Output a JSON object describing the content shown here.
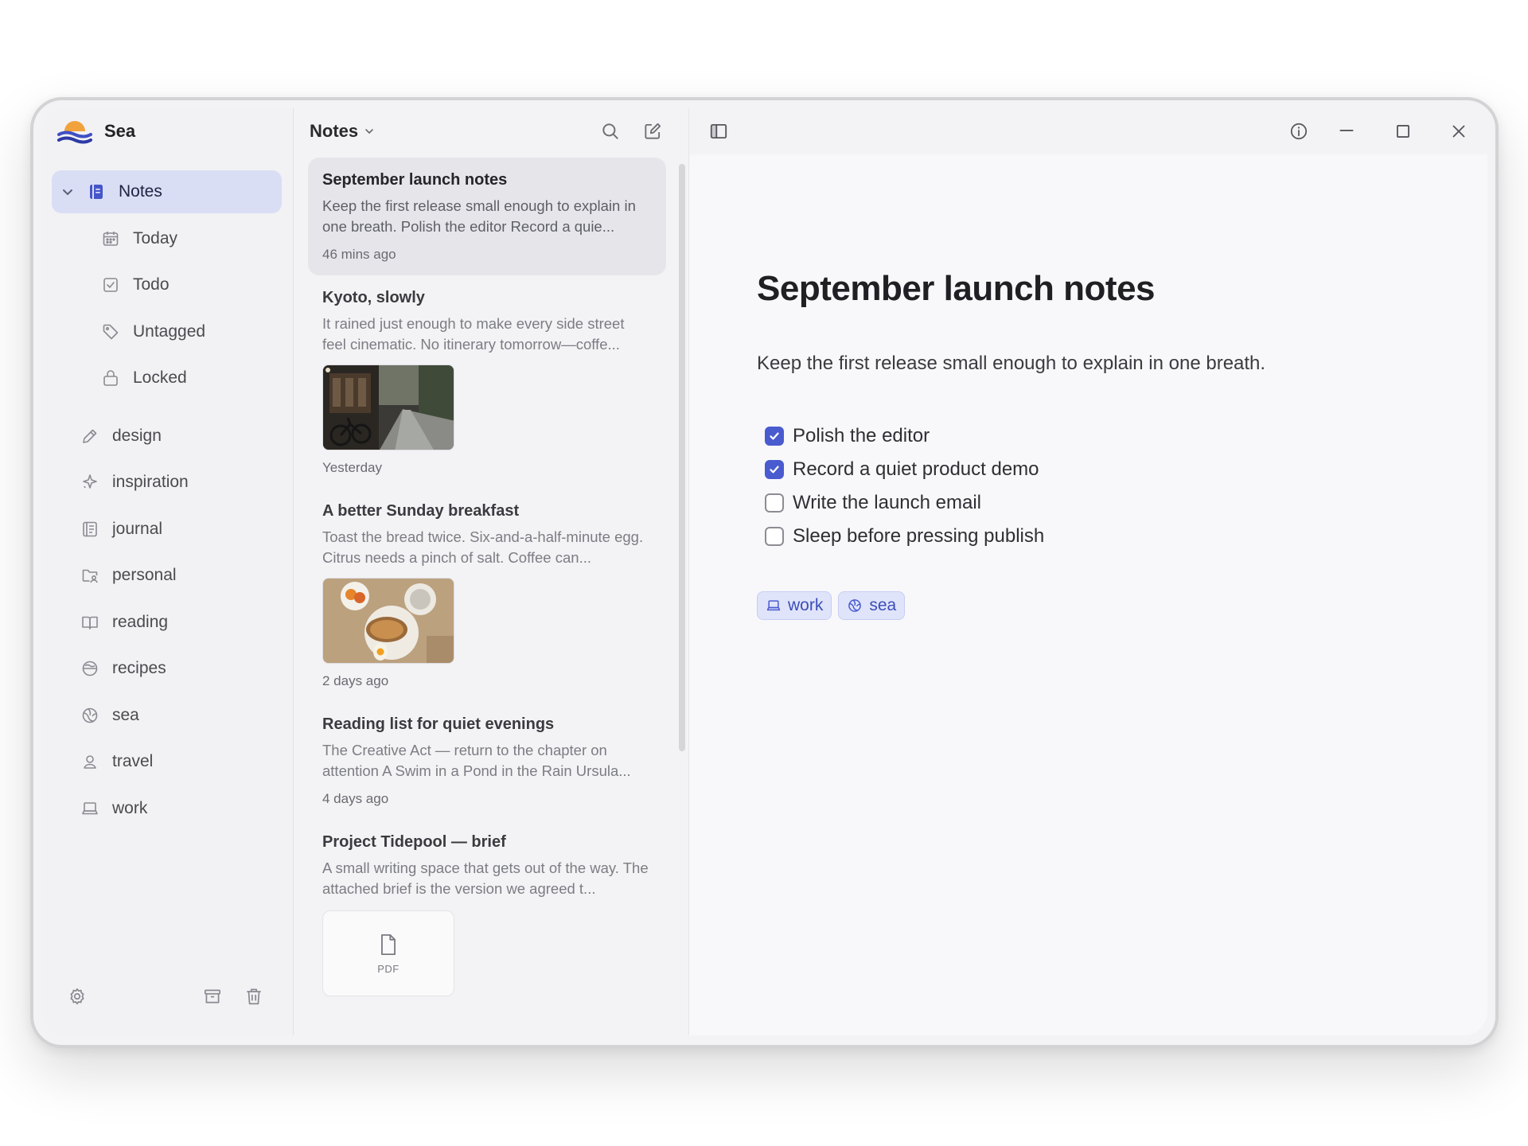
{
  "app": {
    "name": "Sea"
  },
  "sidebar": {
    "notes_label": "Notes",
    "sub_items": [
      {
        "label": "Today",
        "icon": "calendar-icon"
      },
      {
        "label": "Todo",
        "icon": "checkbox-icon"
      },
      {
        "label": "Untagged",
        "icon": "tag-icon"
      },
      {
        "label": "Locked",
        "icon": "lock-icon"
      }
    ],
    "tags": [
      {
        "label": "design",
        "icon": "pencil-icon"
      },
      {
        "label": "inspiration",
        "icon": "sparkle-icon"
      },
      {
        "label": "journal",
        "icon": "journal-icon"
      },
      {
        "label": "personal",
        "icon": "folder-user-icon"
      },
      {
        "label": "reading",
        "icon": "book-icon"
      },
      {
        "label": "recipes",
        "icon": "bowl-icon"
      },
      {
        "label": "sea",
        "icon": "globe-icon"
      },
      {
        "label": "travel",
        "icon": "pin-icon"
      },
      {
        "label": "work",
        "icon": "laptop-icon"
      }
    ]
  },
  "list": {
    "title": "Notes",
    "notes": [
      {
        "title": "September launch notes",
        "snippet": "Keep the first release small enough to explain in one breath. Polish the editor Record a quie...",
        "time": "46 mins ago"
      },
      {
        "title": "Kyoto, slowly",
        "snippet": "It rained just enough to make every side street feel cinematic. No itinerary tomorrow—coffe...",
        "time": "Yesterday",
        "attachment": "photo"
      },
      {
        "title": "A better Sunday breakfast",
        "snippet": "Toast the bread twice. Six-and-a-half-minute egg. Citrus needs a pinch of salt. Coffee can...",
        "time": "2 days ago",
        "attachment": "photo"
      },
      {
        "title": "Reading list for quiet evenings",
        "snippet": "The Creative Act — return to the chapter on attention A Swim in a Pond in the Rain Ursula...",
        "time": "4 days ago"
      },
      {
        "title": "Project Tidepool — brief",
        "snippet": "A small writing space that gets out of the way. The attached brief is the version we agreed t...",
        "attachment_label": "PDF"
      }
    ]
  },
  "editor": {
    "title": "September launch notes",
    "paragraph": "Keep the first release small enough to explain in one breath.",
    "checklist": [
      {
        "label": "Polish the editor",
        "checked": true
      },
      {
        "label": "Record a quiet product demo",
        "checked": true
      },
      {
        "label": "Write the launch email",
        "checked": false
      },
      {
        "label": "Sleep before pressing publish",
        "checked": false
      }
    ],
    "tags": [
      {
        "label": "work",
        "icon": "laptop-icon"
      },
      {
        "label": "sea",
        "icon": "globe-icon"
      }
    ]
  },
  "colors": {
    "accent": "#4a5bd0",
    "active_nav_bg": "#d9def5",
    "tag_bg": "#e0e4fa"
  }
}
